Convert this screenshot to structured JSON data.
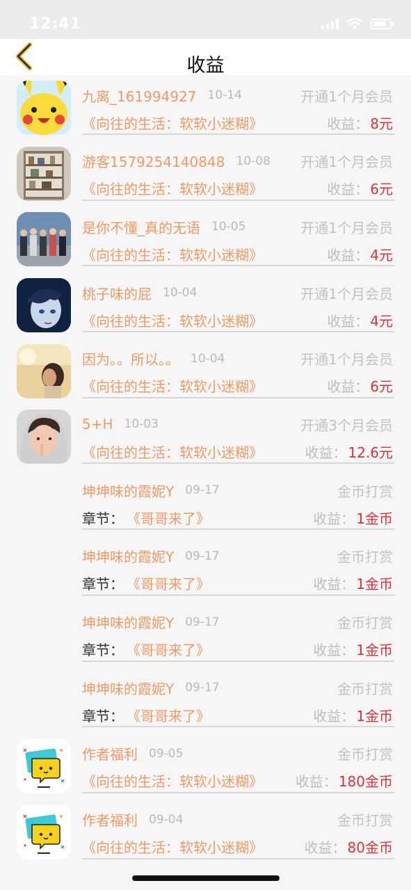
{
  "status_bar": {
    "time": "12:41"
  },
  "nav": {
    "title": "收益"
  },
  "labels": {
    "earnings_prefix": "收益：",
    "chapter_prefix": "章节："
  },
  "colors": {
    "accent_orange": "#ee9a66",
    "value_red": "#d9303a",
    "muted_gray": "#c2c2c2"
  },
  "records": [
    {
      "username": "九离_161994927",
      "date": "10-14",
      "type": "开通1个月会员",
      "book": "《向往的生活：软软小迷糊》",
      "amount": "8元",
      "avatar": "pikachu-avatar"
    },
    {
      "username": "游客1579254140848",
      "date": "10-08",
      "type": "开通1个月会员",
      "book": "《向往的生活：软软小迷糊》",
      "amount": "6元",
      "avatar": "shelf-photo-avatar"
    },
    {
      "username": "是你不懂_真的无语",
      "date": "10-05",
      "type": "开通1个月会员",
      "book": "《向往的生活：软软小迷糊》",
      "amount": "4元",
      "avatar": "group-photo-avatar"
    },
    {
      "username": "桃子味的屁",
      "date": "10-04",
      "type": "开通1个月会员",
      "book": "《向往的生活：软软小迷糊》",
      "amount": "4元",
      "avatar": "anime-boy-avatar"
    },
    {
      "username": "因为。。所以。。",
      "date": "10-04",
      "type": "开通1个月会员",
      "book": "《向往的生活：软软小迷糊》",
      "amount": "6元",
      "avatar": "sunset-girl-avatar"
    },
    {
      "username": "5+H",
      "date": "10-03",
      "type": "开通3个月会员",
      "book": "《向往的生活：软软小迷糊》",
      "amount": "12.6元",
      "avatar": "hooded-person-avatar"
    },
    {
      "username": "坤坤味的霞妮Y",
      "date": "09-17",
      "type": "金币打赏",
      "book": "《哥哥来了》",
      "amount": "1金币",
      "avatar": "none",
      "has_chapter_prefix": true
    },
    {
      "username": "坤坤味的霞妮Y",
      "date": "09-17",
      "type": "金币打赏",
      "book": "《哥哥来了》",
      "amount": "1金币",
      "avatar": "none",
      "has_chapter_prefix": true
    },
    {
      "username": "坤坤味的霞妮Y",
      "date": "09-17",
      "type": "金币打赏",
      "book": "《哥哥来了》",
      "amount": "1金币",
      "avatar": "none",
      "has_chapter_prefix": true
    },
    {
      "username": "坤坤味的霞妮Y",
      "date": "09-17",
      "type": "金币打赏",
      "book": "《哥哥来了》",
      "amount": "1金币",
      "avatar": "none",
      "has_chapter_prefix": true
    },
    {
      "username": "作者福利",
      "date": "09-05",
      "type": "金币打赏",
      "book": "《向往的生活：软软小迷糊》",
      "amount": "180金币",
      "avatar": "chat-bubble-avatar"
    },
    {
      "username": "作者福利",
      "date": "09-04",
      "type": "金币打赏",
      "book": "《向往的生活：软软小迷糊》",
      "amount": "80金币",
      "avatar": "chat-bubble-avatar"
    }
  ]
}
